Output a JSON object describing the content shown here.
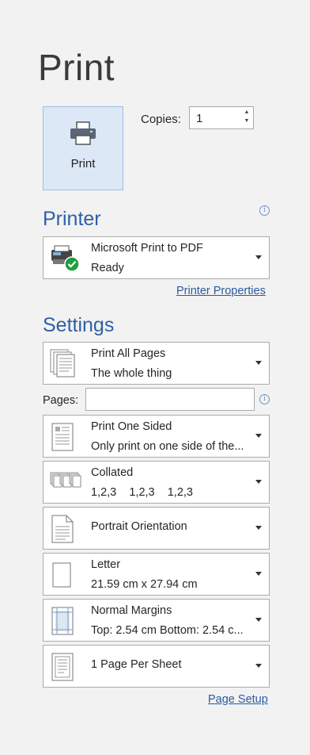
{
  "title": "Print",
  "print_button": {
    "label": "Print"
  },
  "copies": {
    "label": "Copies:",
    "value": "1"
  },
  "printer": {
    "heading": "Printer",
    "name": "Microsoft Print to PDF",
    "status": "Ready",
    "properties_link": "Printer Properties"
  },
  "settings": {
    "heading": "Settings",
    "pages_label": "Pages:",
    "pages_value": "",
    "page_setup_link": "Page Setup",
    "items": [
      {
        "main": "Print All Pages",
        "sub": "The whole thing",
        "icon": "pages-stack-icon"
      },
      {
        "main": "Print One Sided",
        "sub": "Only print on one side of the...",
        "icon": "one-sided-icon"
      },
      {
        "main": "Collated",
        "sub": "1,2,3    1,2,3    1,2,3",
        "icon": "collated-icon"
      },
      {
        "main": "Portrait Orientation",
        "sub": "",
        "icon": "portrait-icon"
      },
      {
        "main": "Letter",
        "sub": "21.59 cm x 27.94 cm",
        "icon": "paper-size-icon"
      },
      {
        "main": "Normal Margins",
        "sub": "Top: 2.54 cm Bottom: 2.54 c...",
        "icon": "margins-icon"
      },
      {
        "main": "1 Page Per Sheet",
        "sub": "",
        "icon": "pages-per-sheet-icon"
      }
    ]
  },
  "colors": {
    "accent": "#2e5fa5",
    "link": "#2c5aa0",
    "print_button_bg": "#dce8f6",
    "ready_check": "#1e9e3e"
  }
}
